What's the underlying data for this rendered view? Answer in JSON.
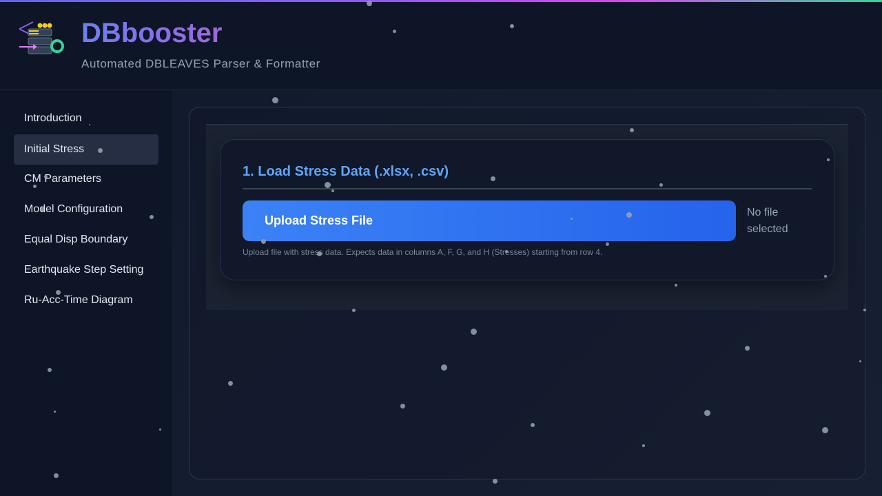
{
  "app": {
    "title": "DBbooster",
    "subtitle": "Automated DBLEAVES Parser & Formatter",
    "logo_icon": "server-stack-logo-icon"
  },
  "sidebar": {
    "items": [
      {
        "label": "Introduction",
        "active": false
      },
      {
        "label": "Initial Stress",
        "active": true
      },
      {
        "label": "CM Parameters",
        "active": false
      },
      {
        "label": "Model Configuration",
        "active": false
      },
      {
        "label": "Equal Disp Boundary",
        "active": false
      },
      {
        "label": "Earthquake Step Setting",
        "active": false
      },
      {
        "label": "Ru-Acc-Time Diagram",
        "active": false
      }
    ]
  },
  "card": {
    "title": "1. Load Stress Data (.xlsx, .csv)",
    "upload_button": "Upload Stress File",
    "file_status": "No file selected",
    "help_text": "Upload file with stress data. Expects data in columns A, F, G, and H (Stresses) starting from row 4."
  },
  "colors": {
    "accent": "#3b82f6",
    "title_blue": "#60a5fa",
    "active_nav": "#252e42",
    "background": "#0f172a"
  }
}
